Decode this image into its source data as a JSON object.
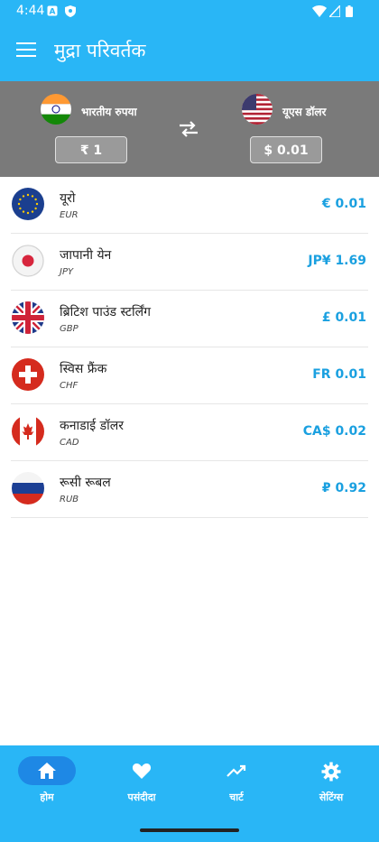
{
  "status_bar": {
    "time": "4:44",
    "icons_left": [
      "a-icon",
      "shield-icon"
    ],
    "icons_right": [
      "wifi-icon",
      "signal-icon",
      "battery-icon"
    ]
  },
  "app_bar": {
    "title": "मुद्रा परिवर्तक"
  },
  "converter": {
    "from": {
      "name": "भारतीय रुपया",
      "amount": "₹ 1",
      "flag": "india-flag-icon"
    },
    "to": {
      "name": "यूएस डॉलर",
      "amount": "$ 0.01",
      "flag": "usa-flag-icon"
    }
  },
  "currencies": [
    {
      "name": "यूरो",
      "code": "EUR",
      "value": "€ 0.01",
      "flag": "eu-flag-icon"
    },
    {
      "name": "जापानी येन",
      "code": "JPY",
      "value": "JP¥ 1.69",
      "flag": "japan-flag-icon"
    },
    {
      "name": "ब्रिटिश पाउंड स्टर्लिंग",
      "code": "GBP",
      "value": "£ 0.01",
      "flag": "uk-flag-icon"
    },
    {
      "name": "स्विस फ्रैंक",
      "code": "CHF",
      "value": "FR 0.01",
      "flag": "swiss-flag-icon"
    },
    {
      "name": "कनाडाई डॉलर",
      "code": "CAD",
      "value": "CA$ 0.02",
      "flag": "canada-flag-icon"
    },
    {
      "name": "रूसी रूबल",
      "code": "RUB",
      "value": "₽ 0.92",
      "flag": "russia-flag-icon"
    }
  ],
  "nav": [
    {
      "label": "होम",
      "icon": "home-icon",
      "active": true
    },
    {
      "label": "पसंदीदा",
      "icon": "heart-icon",
      "active": false
    },
    {
      "label": "चार्ट",
      "icon": "trending-up-icon",
      "active": false
    },
    {
      "label": "सेटिंग्स",
      "icon": "gear-icon",
      "active": false
    }
  ],
  "colors": {
    "primary": "#29b6f6",
    "converter_bg": "#7a7a7a",
    "value_text": "#1aa0e0",
    "active_pill": "#1e88e5"
  }
}
